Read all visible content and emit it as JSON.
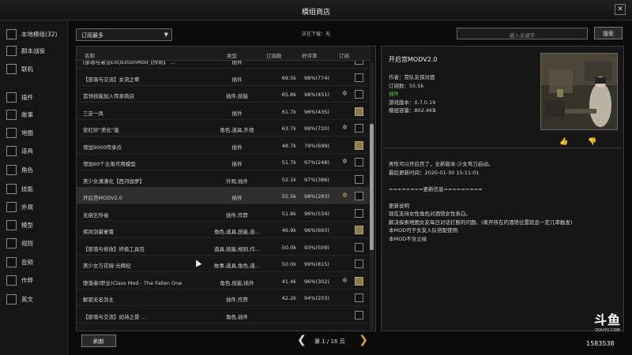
{
  "window": {
    "title": "模组商店",
    "close": "✕"
  },
  "sidebar": {
    "items": [
      {
        "label": "本地模组(32)"
      },
      {
        "label": "剧本战役"
      },
      {
        "label": "联机"
      },
      {
        "label": "插件"
      },
      {
        "label": "故事"
      },
      {
        "label": "地图"
      },
      {
        "label": "道具"
      },
      {
        "label": "角色"
      },
      {
        "label": "技能"
      },
      {
        "label": "外观"
      },
      {
        "label": "模型"
      },
      {
        "label": "规则"
      },
      {
        "label": "音频"
      },
      {
        "label": "作弊"
      },
      {
        "label": "英文"
      }
    ]
  },
  "toolbar": {
    "sort_selected": "订阅最多",
    "sort_arrow": "▼",
    "downloading": "正在下载：无",
    "search_placeholder": "键入关键字",
    "search_label": "搜索"
  },
  "table": {
    "headers": {
      "name": "名称",
      "type": "类型",
      "subs": "订阅数",
      "rate": "好评率",
      "subscribe": "订阅"
    },
    "rows": [
      {
        "name": "[部落与弟法Ext]ExtionMod【传奇】 ...",
        "type": "插件",
        "subs": "",
        "rate": "",
        "star": false,
        "checked": false
      },
      {
        "name": "【部落与交流】女流之辈",
        "type": "插件",
        "subs": "69.5k",
        "rate": "98%(774)",
        "star": false,
        "checked": false
      },
      {
        "name": "首领技能加入传承商店",
        "type": "插件,技能",
        "subs": "65.8k",
        "rate": "98%(451)",
        "star": true,
        "checked": false
      },
      {
        "name": "三足一凤",
        "type": "插件",
        "subs": "61.7k",
        "rate": "96%(435)",
        "star": false,
        "checked": true
      },
      {
        "name": "安红砂“美化”版",
        "type": "角色,道具,外观",
        "subs": "63.7k",
        "rate": "98%(720)",
        "star": true,
        "checked": false
      },
      {
        "name": "增加9000传承点",
        "type": "插件",
        "subs": "48.7k",
        "rate": "79%(699)",
        "star": false,
        "checked": true
      },
      {
        "name": "增加60个主角可用模型",
        "type": "插件",
        "subs": "51.7k",
        "rate": "97%(248)",
        "star": true,
        "checked": false
      },
      {
        "name": "美少女潇潇化【西河伽罗】",
        "type": "外观,插件",
        "subs": "52.1k",
        "rate": "97%(386)",
        "star": false,
        "checked": false
      },
      {
        "name": "开后宫MODV2.0",
        "type": "插件",
        "subs": "55.5k",
        "rate": "98%(283)",
        "star": true,
        "checked": false
      },
      {
        "name": "无偿乞怜者",
        "type": "插件,作弊",
        "subs": "51.8k",
        "rate": "96%(534)",
        "star": false,
        "checked": false
      },
      {
        "name": "疾风剑豪宴寰",
        "type": "角色,道具,技能,音...",
        "subs": "46.9k",
        "rate": "96%(693)",
        "star": false,
        "checked": true
      },
      {
        "name": "【部落与修改】终极工具包",
        "type": "道具,技能,规则,作...",
        "subs": "50.0k",
        "rate": "93%(509)",
        "star": false,
        "checked": false
      },
      {
        "name": "美少女万花镜·光辉纪",
        "type": "故事,道具,角色,道...",
        "subs": "50.0k",
        "rate": "99%(815)",
        "star": false,
        "checked": false
      },
      {
        "name": "堕落者(职业)Class Mod - The Fallen One",
        "type": "角色,技能,插件",
        "subs": "41.4k",
        "rate": "96%(302)",
        "star": true,
        "checked": true
      },
      {
        "name": "解锁无名剑主",
        "type": "插件,作弊",
        "subs": "42.2k",
        "rate": "94%(203)",
        "star": false,
        "checked": false
      },
      {
        "name": "【部落与交流】如诗之景 ...",
        "type": "角色,插件",
        "subs": "",
        "rate": "",
        "star": false,
        "checked": false
      }
    ]
  },
  "footer": {
    "refresh": "刷新",
    "prev": "❮",
    "next": "❯",
    "page": "第 1 / 16 页"
  },
  "detail": {
    "name": "开后宫MODV2.0",
    "author": "作者：劳队友保对面",
    "subs": "订阅数：55.5k",
    "tag": "插件",
    "game_version": "游戏版本：0.7.0.19",
    "size": "模组容量：802.4KB",
    "like": "👍",
    "dislike": "👎",
    "desc_lines": [
      "男性可以开后宫了，全新版本-少女弯刀启动。",
      "最后更新时间：2020-01-30 15:11:01",
      "",
      "========更新信息=========",
      "",
      "更新说明",
      "现在支持女性角色对酒馆女性表白。",
      "解决探索地图女友每日对话打断的问题。(离开所在的酒馆位置就会一定几率触发)",
      "本MOD可于女友入队搭配使用.",
      "本MOD不含立绘"
    ]
  },
  "watermark": {
    "logo": "斗鱼",
    "sub": "DOUYU.COM",
    "room": "1583538"
  },
  "colors": {
    "accent": "#d9a52b",
    "green": "#4fd14f",
    "checked": "#8b7b4f"
  }
}
